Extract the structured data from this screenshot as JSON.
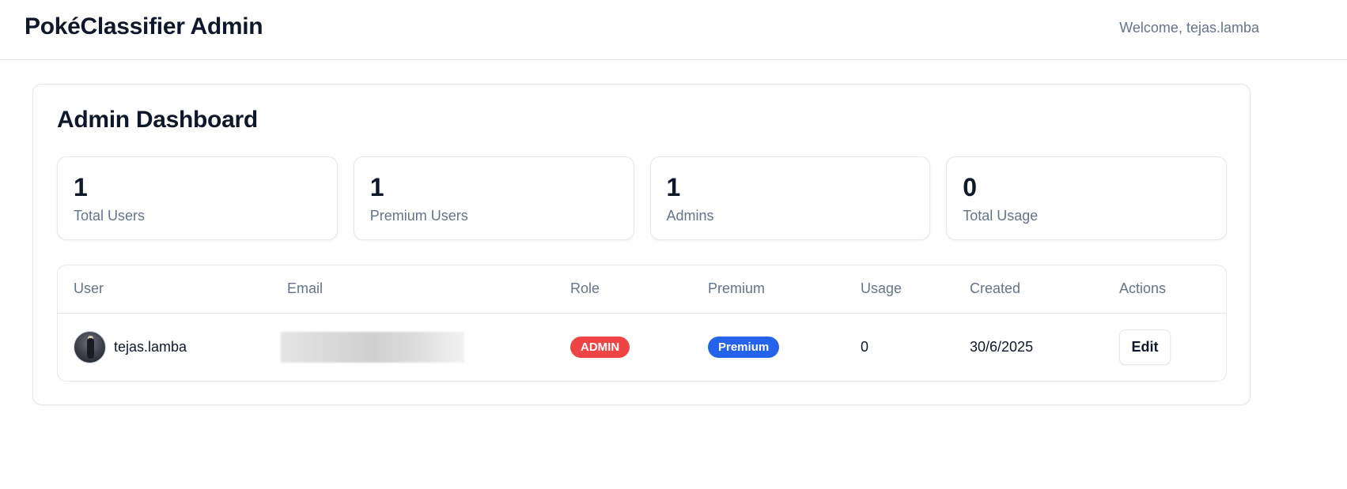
{
  "header": {
    "app_title": "PokéClassifier Admin",
    "welcome_text": "Welcome, tejas.lamba"
  },
  "dashboard": {
    "title": "Admin Dashboard",
    "stats": [
      {
        "value": "1",
        "label": "Total Users"
      },
      {
        "value": "1",
        "label": "Premium Users"
      },
      {
        "value": "1",
        "label": "Admins"
      },
      {
        "value": "0",
        "label": "Total Usage"
      }
    ]
  },
  "table": {
    "columns": [
      "User",
      "Email",
      "Role",
      "Premium",
      "Usage",
      "Created",
      "Actions"
    ],
    "rows": [
      {
        "user": "tejas.lamba",
        "email": "",
        "role": "ADMIN",
        "premium": "Premium",
        "usage": "0",
        "created": "30/6/2025",
        "action": "Edit"
      }
    ]
  },
  "colors": {
    "role_admin": "#ef4444",
    "premium_badge": "#2563eb",
    "muted_text": "#64748b",
    "border": "#e5e7eb"
  }
}
